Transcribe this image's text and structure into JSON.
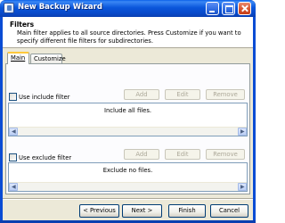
{
  "window": {
    "title": "New Backup Wizard",
    "colors": {
      "titlebar": "#0a56db",
      "close_button": "#d9542d",
      "face": "#ece9d8",
      "tab_highlight": "#ffc83c"
    }
  },
  "header": {
    "title": "Filters",
    "description": "Main filter applies to all source directories. Press Customize if you want to specify different file filters for subdirectories."
  },
  "tabs": [
    {
      "label": "Main",
      "selected": true
    },
    {
      "label": "Customize",
      "selected": false
    }
  ],
  "include_filter": {
    "checkbox_label": "Use include filter",
    "checked": false,
    "buttons": {
      "add": "Add",
      "edit": "Edit",
      "remove": "Remove"
    },
    "list_text": "Include all files."
  },
  "exclude_filter": {
    "checkbox_label": "Use exclude filter",
    "checked": false,
    "buttons": {
      "add": "Add",
      "edit": "Edit",
      "remove": "Remove"
    },
    "list_text": "Exclude no files."
  },
  "footer": {
    "previous": "< Previous",
    "next": "Next >",
    "finish": "Finish",
    "cancel": "Cancel"
  },
  "icons": {
    "app": "backup-wizard-icon",
    "minimize": "minimize-icon",
    "maximize": "maximize-icon",
    "close": "close-icon"
  }
}
